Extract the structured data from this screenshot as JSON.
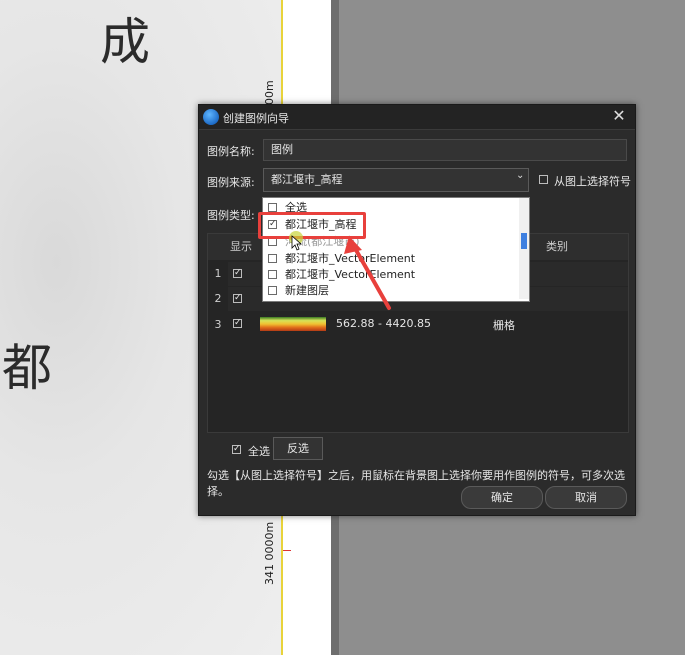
{
  "background_map": {
    "chars": [
      "成",
      "都"
    ],
    "coord_top": "00m",
    "coord_bottom": "341 0000m"
  },
  "dialog": {
    "title": "创建图例向导",
    "close_glyph": "✕",
    "name_label": "图例名称:",
    "name_value": "图例",
    "source_label": "图例来源:",
    "source_value": "都江堰市_高程",
    "pick_from_map_label": "从图上选择符号",
    "type_label": "图例类型:",
    "table": {
      "columns": [
        "显示",
        "类别"
      ],
      "rows": [
        {
          "num": "1",
          "checked": true,
          "range": "",
          "category": ""
        },
        {
          "num": "2",
          "checked": true,
          "range": "",
          "category": ""
        },
        {
          "num": "3",
          "checked": true,
          "range": "562.88 - 4420.85",
          "category": "栅格"
        }
      ]
    },
    "select_all_label": "全选",
    "invert_label": "反选",
    "hint": "勾选【从图上选择符号】之后，用鼠标在背景图上选择你要用作图例的符号，可多次选择。",
    "ok_label": "确定",
    "cancel_label": "取消"
  },
  "dropdown": {
    "items": [
      {
        "label": "全选",
        "checked": false
      },
      {
        "label": "都江堰市_高程",
        "checked": true
      },
      {
        "label": "河流(都江堰市)",
        "checked": false
      },
      {
        "label": "都江堰市_VectorElement",
        "checked": false
      },
      {
        "label": "都江堰市_VectorElement",
        "checked": false
      },
      {
        "label": "新建图层",
        "checked": false
      }
    ]
  },
  "colors": {
    "highlight": "#e8403c",
    "accent": "#3d7fe0"
  },
  "check_glyph": "✓"
}
